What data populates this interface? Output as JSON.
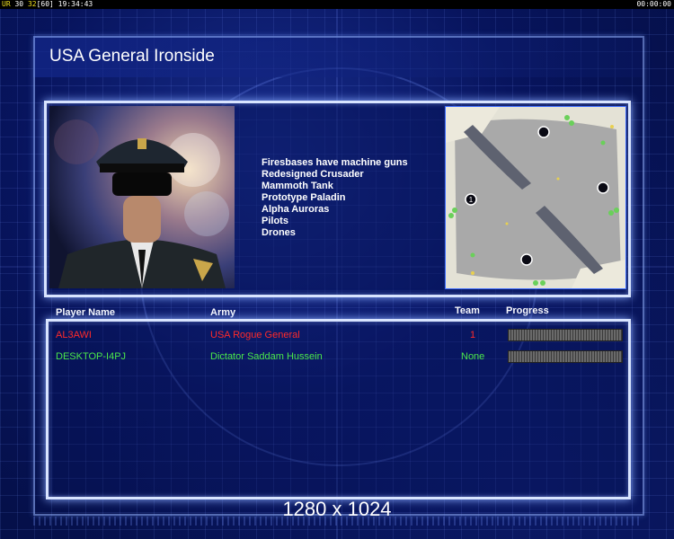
{
  "hud": {
    "left": {
      "ur": "UR",
      "fps": "30",
      "frame": "32",
      "limit": "[60]",
      "clock": "19:34:43"
    },
    "right": "00:00:00"
  },
  "title": "USA General Ironside",
  "features": [
    "Firesbases have machine guns",
    "Redesigned Crusader",
    "Mammoth Tank",
    "Prototype Paladin",
    "Alpha Auroras",
    "Pilots",
    "Drones"
  ],
  "table": {
    "headers": {
      "player": "Player Name",
      "army": "Army",
      "team": "Team",
      "progress": "Progress"
    },
    "rows": [
      {
        "player": "AL3AWI",
        "army": "USA Rogue General",
        "team": "1",
        "color": "#ff2a2a"
      },
      {
        "player": "DESKTOP-I4PJ",
        "army": "Dictator Saddam Hussein",
        "team": "None",
        "color": "#4be84b"
      }
    ]
  },
  "map": {
    "start_positions": [
      "1"
    ]
  },
  "resolution": "1280 x 1024",
  "colors": {
    "accent": "#d8e4ff",
    "background": "#05104a"
  },
  "icons": {
    "portrait": "general-portrait-image",
    "minimap": "minimap-image"
  }
}
